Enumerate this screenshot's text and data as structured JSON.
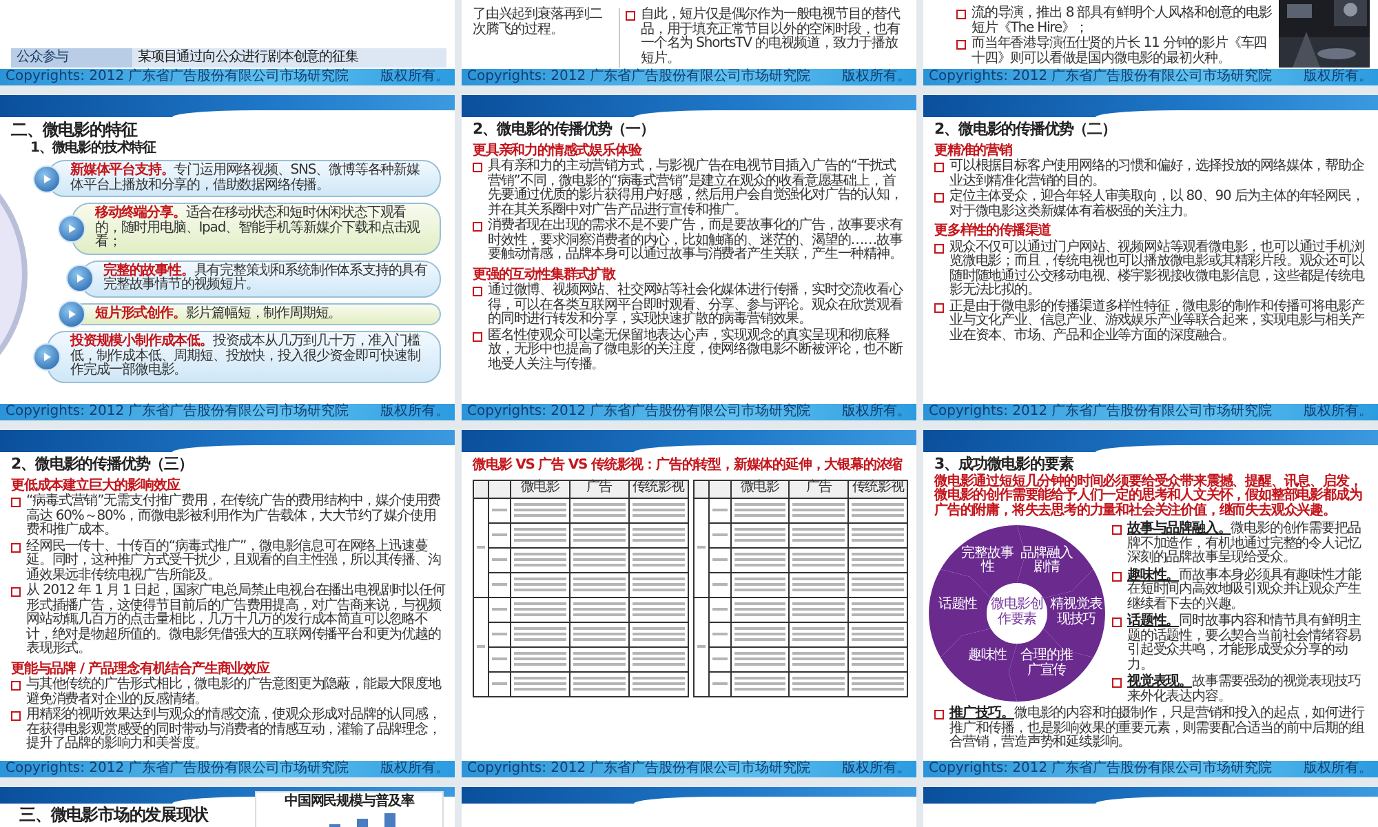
{
  "slides": [
    {
      "kind": "table_tail",
      "rows": [
        {
          "label": "公众参与",
          "text": "某项目通过向公众进行剧本创意的征集"
        }
      ],
      "footer": "Copyrights: 2012 广东省广告股份有限公司市场研究院",
      "rights": "版权所有。"
    },
    {
      "kind": "split_text",
      "left": "了由兴起到衰落再到二次腾飞的过程。",
      "right": [
        "自此，短片仅是偶尔作为一般电视节目的替代品，用于填充正常节目以外的空闲时段，也有一个名为 ShortsTV 的电视频道，致力于播放短片。"
      ],
      "footer": "Copyrights: 2012 广东省广告股份有限公司市场研究院",
      "rights": "版权所有。"
    },
    {
      "kind": "bullets_picture",
      "bullets": [
        "流的导演，推出 8 部具有鲜明个人风格和创意的电影短片《The Hire》；",
        "而当年香港导演伍仕贤的片长 11 分钟的影片《车四十四》则可以看做是国内微电影的最初火种。"
      ],
      "footer": "Copyrights: 2012 广东省广告股份有限公司市场研究院",
      "rights": "版权所有。"
    },
    {
      "kind": "features",
      "title": "二、微电影的特征",
      "subtitle": "1、微电影的技术特征",
      "items": [
        {
          "lead": "新媒体平台支持。",
          "text": "专门运用网络视频、SNS、微博等各种新媒体平台上播放和分享的，借助数据网络传播。"
        },
        {
          "lead": "移动终端分享。",
          "text": "适合在移动状态和短时休闲状态下观看的，随时用电脑、Ipad、智能手机等新媒介下载和点击观看；"
        },
        {
          "lead": "完整的故事性。",
          "text": "具有完整策划和系统制作体系支持的具有完整故事情节的视频短片。"
        },
        {
          "lead": "短片形式创作。",
          "text": "影片篇幅短，制作周期短。"
        },
        {
          "lead": "投资规模小制作成本低。",
          "text": "投资成本从几万到几十万，准入门槛低，制作成本低、周期短、投放快，投入很少资金即可快速制作完成一部微电影。"
        }
      ],
      "footer": "Copyrights: 2012 广东省广告股份有限公司市场研究院",
      "rights": "版权所有。"
    },
    {
      "kind": "sections",
      "title": "2、微电影的传播优势（一）",
      "sections": [
        {
          "heading": "更具亲和力的情感式娱乐体验",
          "bullets": [
            "具有亲和力的主动营销方式，与影视广告在电视节目插入广告的“干扰式营销”不同，微电影的“病毒式营销”是建立在观众的收看意愿基础上，首先要通过优质的影片获得用户好感，然后用户会自觉强化对广告的认知，并在其关系圈中对广告产品进行宣传和推广。",
            "消费者现在出现的需求不是不要广告，而是要故事化的广告，故事要求有时效性，要求洞察消费者的内心，比如触痛的、迷茫的、渴望的……故事要触动情感，品牌本身可以通过故事与消费者产生关联，产生一种精神。"
          ]
        },
        {
          "heading": "更强的互动性集群式扩散",
          "bullets": [
            "通过微博、视频网站、社交网站等社会化媒体进行传播，实时交流收看心得，可以在各类互联网平台即时观看、分享、参与评论。观众在欣赏观看的同时进行转发和分享，实现快速扩散的病毒营销效果。",
            "匿名性使观众可以毫无保留地表达心声，实现观念的真实呈现和彻底释放，无形中也提高了微电影的关注度，使网络微电影不断被评论，也不断地受人关注与传播。"
          ]
        }
      ],
      "footer": "Copyrights: 2012 广东省广告股份有限公司市场研究院",
      "rights": "版权所有。"
    },
    {
      "kind": "sections",
      "title": "2、微电影的传播优势（二）",
      "sections": [
        {
          "heading": "更精准的营销",
          "bullets": [
            "可以根据目标客户使用网络的习惯和偏好，选择投放的网络媒体，帮助企业达到精准化营销的目的。",
            "定位主体受众，迎合年轻人审美取向，以 80、90 后为主体的年轻网民，对于微电影这类新媒体有着极强的关注力。"
          ]
        },
        {
          "heading": "更多样性的传播渠道",
          "bullets": [
            "观众不仅可以通过门户网站、视频网站等观看微电影，也可以通过手机浏览微电影；而且，传统电视也可以播放微电影或其精彩片段。观众还可以随时随地通过公交移动电视、楼宇影视接收微电影信息，这些都是传统电影无法比拟的。",
            "正是由于微电影的传播渠道多样性特征，微电影的制作和传播可将电影产业与文化产业、信息产业、游戏娱乐产业等联合起来，实现电影与相关产业在资本、市场、产品和企业等方面的深度融合。"
          ]
        }
      ],
      "footer": "Copyrights: 2012 广东省广告股份有限公司市场研究院",
      "rights": "版权所有。"
    },
    {
      "kind": "sections",
      "title": "2、微电影的传播优势（三）",
      "sections": [
        {
          "heading": "更低成本建立巨大的影响效应",
          "bullets": [
            "“病毒式营销”无需支付推广费用，在传统广告的费用结构中，媒介使用费高达 60%～80%，而微电影被利用作为广告载体，大大节约了媒介使用费和推广成本。",
            "经网民一传十、十传百的“病毒式推广”，微电影信息可在网络上迅速蔓延。同时，这种推广方式受干扰少，且观看的自主性强，所以其传播、沟通效果远非传统电视广告所能及。",
            "从 2012 年 1 月 1 日起，国家广电总局禁止电视台在播出电视剧时以任何形式插播广告，这使得节目前后的广告费用提高，对广告商来说，与视频网站动辄几百万的点击量相比，几万十几万的发行成本简直可以忽略不计，绝对是物超所值的。微电影凭借强大的互联网传播平台和更为优越的表现形式。"
          ]
        },
        {
          "heading": "更能与品牌 / 产品理念有机结合产生商业效应",
          "bullets": [
            "与其他传统的广告形式相比，微电影的广告意图更为隐蔽，能最大限度地避免消费者对企业的反感情绪。",
            "用精彩的视听效果达到与观众的情感交流，使观众形成对品牌的认同感，在获得电影观赏感受的同时带动与消费者的情感互动，灌输了品牌理念，提升了品牌的影响力和美誉度。"
          ]
        }
      ],
      "footer": "Copyrights: 2012 广东省广告股份有限公司市场研究院",
      "rights": "版权所有。"
    },
    {
      "kind": "comparison",
      "title": "微电影 VS 广告 VS 传统影视：广告的转型，新媒体的延伸，大银幕的浓缩",
      "tables": [
        {
          "columns": [
            "微电影",
            "广告",
            "传统影视"
          ]
        },
        {
          "columns": [
            "微电影",
            "广告",
            "传统影视"
          ]
        }
      ],
      "footer": "Copyrights: 2012 广东省广告股份有限公司市场研究院",
      "rights": "版权所有。"
    },
    {
      "kind": "elements",
      "title": "3、成功微电影的要素",
      "intro": "微电影通过短短几分钟的时间必须要给受众带来震撼、提醒、讯息、启发，微电影的创作需要能给予人们一定的思考和人文关怀，假如整部电影都成为广告的附庸，将失去思考的力量和社会关注价值，继而失去观众兴趣。",
      "cycle": {
        "center": "微电影创作要素",
        "labels": [
          "完整故事性",
          "品牌融入剧情",
          "话题性",
          "精视觉表现技巧",
          "趣味性",
          "合理的推广宣传"
        ]
      },
      "bullets": [
        {
          "lead": "故事与品牌融入。",
          "text": "微电影的创作需要把品牌不加造作，有机地通过完整的令人记忆深刻的品牌故事呈现给受众。"
        },
        {
          "lead": "趣味性。",
          "text": "而故事本身必须具有趣味性才能在短时间内高效地吸引观众并让观众产生继续看下去的兴趣。"
        },
        {
          "lead": "话题性。",
          "text": "同时故事内容和情节具有鲜明主题的话题性，要么契合当前社会情绪容易引起受众共鸣，才能形成受众分享的动力。"
        },
        {
          "lead": "视觉表现。",
          "text": "故事需要强劲的视觉表现技巧来外化表达内容。"
        },
        {
          "lead": "推广技巧。",
          "text": "微电影的内容和拍摄制作，只是营销和投入的起点，如何进行推广和传播，也是影响效果的重要元素，则需要配合适当的前中后期的组合营销，营造声势和延续影响。"
        }
      ],
      "footer": "Copyrights: 2012 广东省广告股份有限公司市场研究院",
      "rights": "版权所有。"
    },
    {
      "kind": "title_chart",
      "title": "三、微电影市场的发展现状",
      "chart_title": "中国网民规模与普及率"
    },
    {
      "kind": "header_only"
    },
    {
      "kind": "header_only"
    }
  ]
}
